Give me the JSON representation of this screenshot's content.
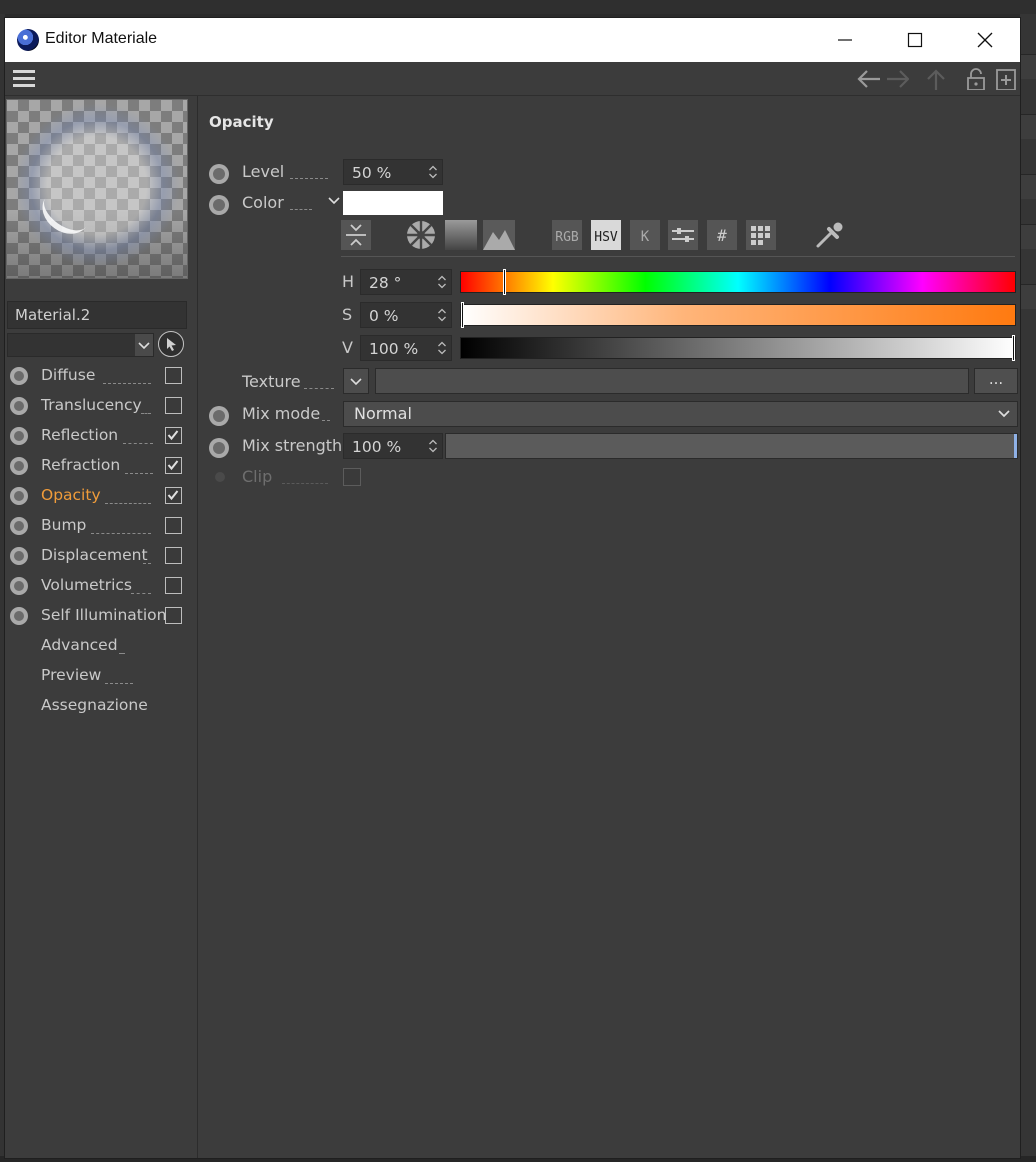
{
  "window": {
    "title": "Editor Materiale"
  },
  "material": {
    "name": "Material.2"
  },
  "channels": [
    {
      "label": "Diffuse",
      "checked": false,
      "has_radio": true,
      "active": false
    },
    {
      "label": "Translucency",
      "checked": false,
      "has_radio": true,
      "active": false
    },
    {
      "label": "Reflection",
      "checked": true,
      "has_radio": true,
      "active": false
    },
    {
      "label": "Refraction",
      "checked": true,
      "has_radio": true,
      "active": false
    },
    {
      "label": "Opacity",
      "checked": true,
      "has_radio": true,
      "active": true
    },
    {
      "label": "Bump",
      "checked": false,
      "has_radio": true,
      "active": false
    },
    {
      "label": "Displacement",
      "checked": false,
      "has_radio": true,
      "active": false
    },
    {
      "label": "Volumetrics",
      "checked": false,
      "has_radio": true,
      "active": false
    },
    {
      "label": "Self Illumination",
      "checked": false,
      "has_radio": true,
      "active": false
    },
    {
      "label": "Advanced",
      "has_radio": false
    },
    {
      "label": "Preview",
      "has_radio": false
    },
    {
      "label": "Assegnazione",
      "has_radio": false
    }
  ],
  "opacity": {
    "section_title": "Opacity",
    "level": {
      "label": "Level",
      "value": "50 %"
    },
    "color": {
      "label": "Color",
      "hex": "#ffffff"
    },
    "color_modes": {
      "rgb": "RGB",
      "hsv": "HSV",
      "kelvin": "K",
      "hash": "#",
      "active": "HSV"
    },
    "hsv": {
      "h": {
        "letter": "H",
        "value": "28 °",
        "fraction": 0.078
      },
      "s": {
        "letter": "S",
        "value": "0 %",
        "fraction": 0.0
      },
      "v": {
        "letter": "V",
        "value": "100 %",
        "fraction": 1.0
      }
    },
    "texture": {
      "label": "Texture",
      "browse": "..."
    },
    "mix_mode": {
      "label": "Mix mode",
      "value": "Normal"
    },
    "mix_strength": {
      "label": "Mix strength",
      "value": "100 %",
      "fraction": 1.0
    },
    "clip": {
      "label": "Clip",
      "checked": false
    }
  },
  "colors": {
    "accent": "#f09c3a",
    "panel": "#3c3c3c"
  }
}
